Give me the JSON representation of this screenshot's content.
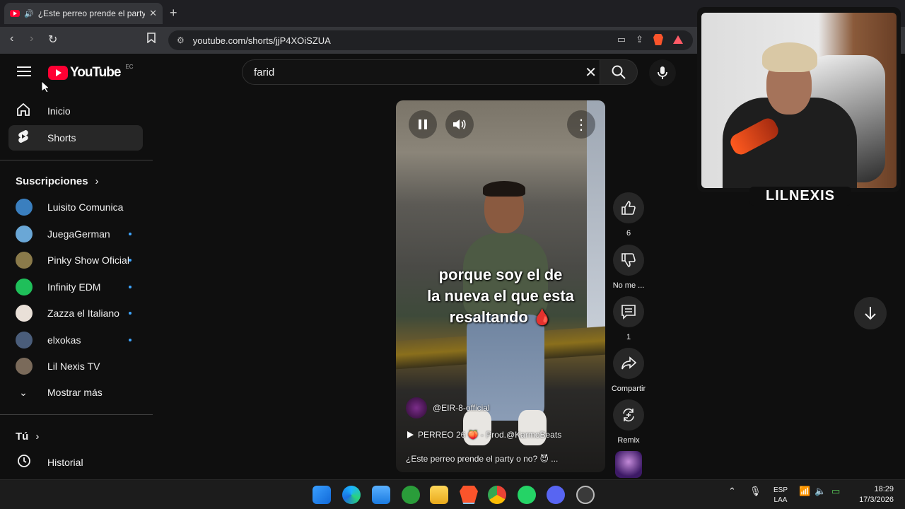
{
  "browser": {
    "tab_title": "¿Este perreo prende el party o no?",
    "url": "youtube.com/shorts/jjP4XOiSZUA"
  },
  "youtube": {
    "logo_text": "YouTube",
    "country_code": "EC",
    "search": {
      "query": "farid"
    },
    "nav": [
      {
        "label": "Inicio",
        "icon": "home-icon"
      },
      {
        "label": "Shorts",
        "icon": "shorts-icon",
        "active": true
      }
    ],
    "subscriptions_heading": "Suscripciones",
    "subscriptions": [
      {
        "name": "Luisito Comunica",
        "color": "#3a7fbf",
        "new": false
      },
      {
        "name": "JuegaGerman",
        "color": "#6aa7d6",
        "new": true
      },
      {
        "name": "Pinky Show Oficial",
        "color": "#8a7a4a",
        "new": true
      },
      {
        "name": "Infinity EDM",
        "color": "#1fbf5a",
        "new": true
      },
      {
        "name": "Zazza el Italiano",
        "color": "#e9e0d8",
        "new": true
      },
      {
        "name": "elxokas",
        "color": "#4a5d7a",
        "new": true
      },
      {
        "name": "Lil Nexis TV",
        "color": "#7a6a5a",
        "new": false
      }
    ],
    "show_more": "Mostrar más",
    "you_heading": "Tú",
    "history": "Historial"
  },
  "short": {
    "caption_lines": [
      "porque soy el de",
      "la nueva el que esta",
      "resaltando 🩸"
    ],
    "channel": "@EIR-8-official",
    "music": "PERREO 26 🍑 - Prod.@KarmoBeats",
    "title": "¿Este perreo prende el party o no? 😈 ..."
  },
  "actions": {
    "like_count": "6",
    "dislike_label": "No me ...",
    "comment_count": "1",
    "share_label": "Compartir",
    "remix_label": "Remix"
  },
  "webcam": {
    "name": "LILNEXIS"
  },
  "taskbar": {
    "lang_top": "ESP",
    "lang_bottom": "LAA",
    "time": "18:29",
    "date": "17/3/2026"
  },
  "colors": {
    "accent": "#ff0033",
    "blue_dot": "#3ea6ff"
  }
}
